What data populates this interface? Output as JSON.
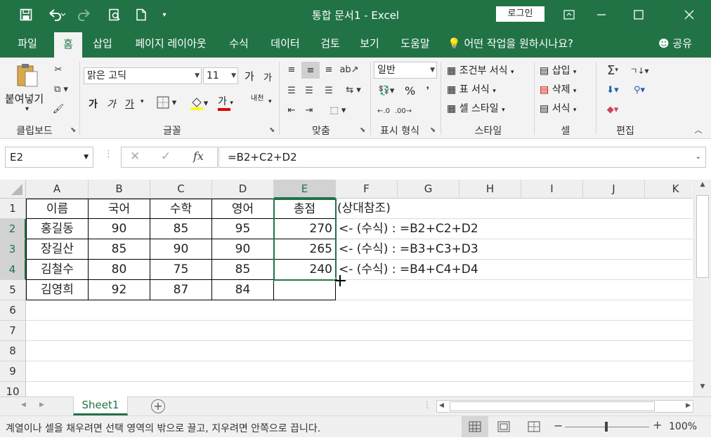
{
  "titlebar": {
    "title": "통합 문서1  -  Excel",
    "login_label": "로그인"
  },
  "tabs": [
    "파일",
    "홈",
    "삽입",
    "페이지 레이아웃",
    "수식",
    "데이터",
    "검토",
    "보기",
    "도움말"
  ],
  "tell_me": "어떤 작업을 원하시나요?",
  "share_label": "공유",
  "ribbon": {
    "clipboard": {
      "paste_label": "붙여넣기",
      "group_label": "클립보드"
    },
    "font": {
      "font_name": "맑은 고딕",
      "font_size": "11",
      "grow": "가",
      "shrink": "가",
      "bold": "가",
      "italic": "가",
      "underline": "가",
      "color_a": "가",
      "phonetic": "내천",
      "group_label": "글꼴"
    },
    "alignment": {
      "group_label": "맞춤"
    },
    "number": {
      "format": "일반",
      "percent": "%",
      "group_label": "표시 형식"
    },
    "styles": {
      "conditional": "조건부 서식",
      "table": "표 서식",
      "cell": "셀 스타일",
      "group_label": "스타일"
    },
    "cells": {
      "insert": "삽입",
      "delete": "삭제",
      "format": "서식",
      "group_label": "셀"
    },
    "editing": {
      "group_label": "편집"
    }
  },
  "formula_bar": {
    "name_box": "E2",
    "fx": "fx",
    "formula": "=B2+C2+D2"
  },
  "columns": [
    "A",
    "B",
    "C",
    "D",
    "E",
    "F",
    "G",
    "H",
    "I",
    "J",
    "K"
  ],
  "rows": [
    "1",
    "2",
    "3",
    "4",
    "5",
    "6",
    "7",
    "8",
    "9",
    "10"
  ],
  "sheet": {
    "r1": {
      "a": "이름",
      "b": "국어",
      "c": "수학",
      "d": "영어",
      "e": "총점",
      "f": "(상대참조)"
    },
    "r2": {
      "a": "홍길동",
      "b": "90",
      "c": "85",
      "d": "95",
      "e": "270",
      "f": "<- (수식) : =B2+C2+D2"
    },
    "r3": {
      "a": "장길산",
      "b": "85",
      "c": "90",
      "d": "90",
      "e": "265",
      "f": "<- (수식) : =B3+C3+D3"
    },
    "r4": {
      "a": "김철수",
      "b": "80",
      "c": "75",
      "d": "85",
      "e": "240",
      "f": "<- (수식) : =B4+C4+D4"
    },
    "r5": {
      "a": "김영희",
      "b": "92",
      "c": "87",
      "d": "84",
      "e": "",
      "f": ""
    }
  },
  "sheet_tab": "Sheet1",
  "status": {
    "message": "계열이나 셀을 채우려면 선택 영역의 밖으로 끌고, 지우려면 안쪽으로 끕니다.",
    "zoom": "100%"
  },
  "colors": {
    "brand": "#217346",
    "ribbon": "#f3f3f3"
  }
}
